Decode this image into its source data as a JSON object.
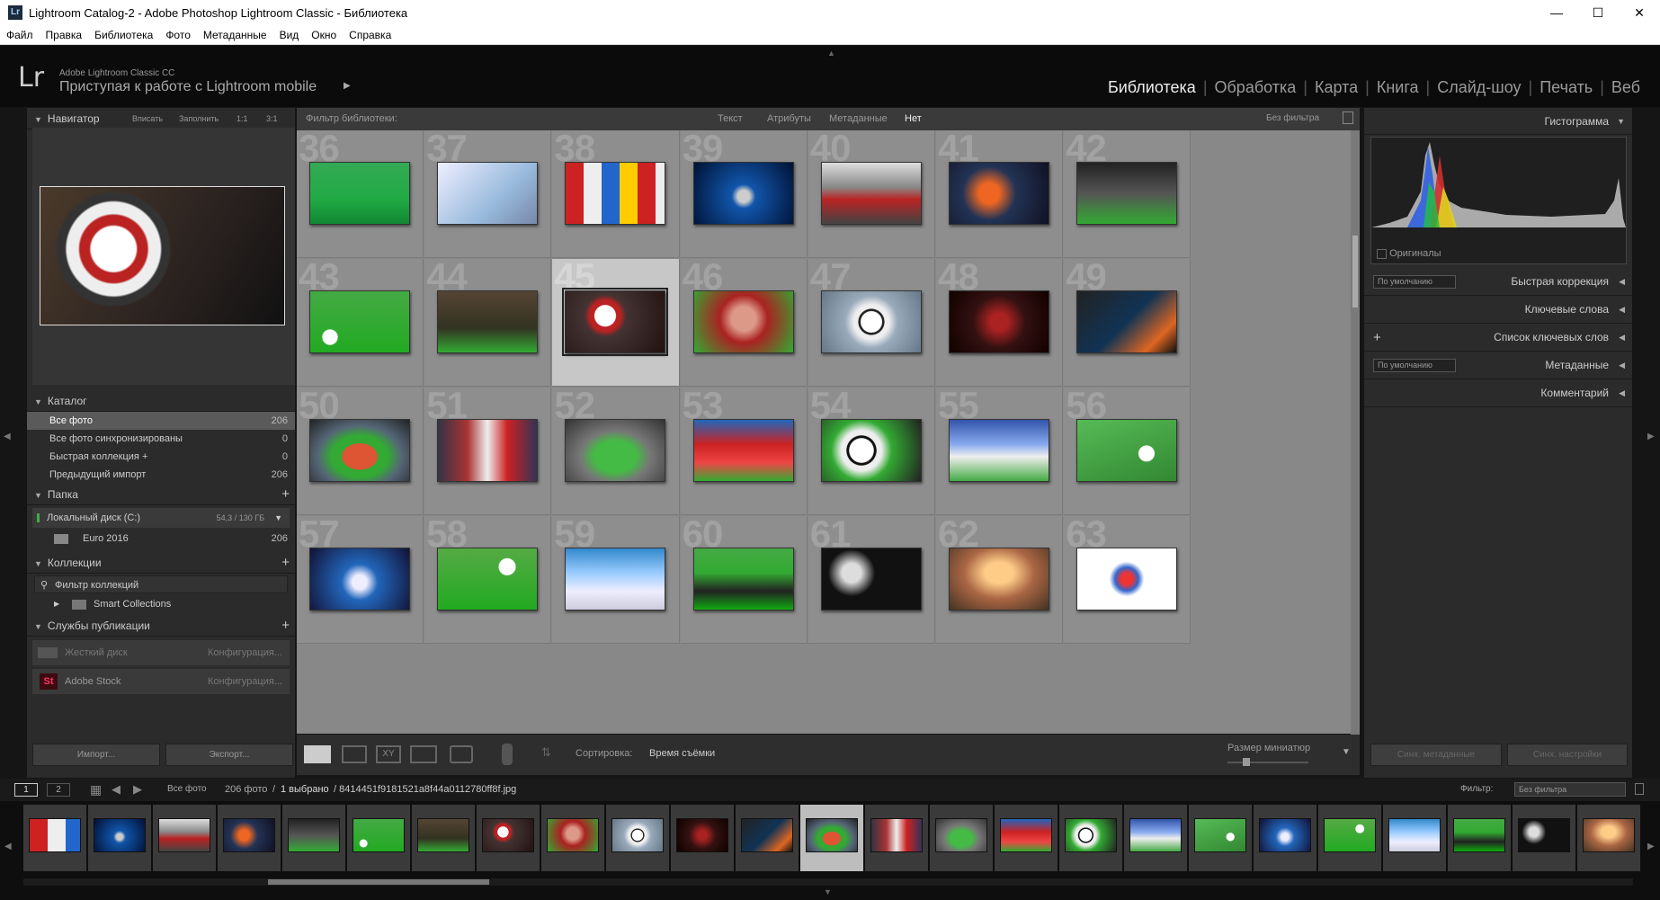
{
  "window": {
    "icon": "Lr",
    "title": "Lightroom Catalog-2 - Adobe Photoshop Lightroom Classic - Библиотека"
  },
  "menu": [
    "Файл",
    "Правка",
    "Библиотека",
    "Фото",
    "Метаданные",
    "Вид",
    "Окно",
    "Справка"
  ],
  "identity": {
    "logo": "Lr",
    "line1": "Adobe Lightroom Classic CC",
    "line2": "Приступая к работе с Lightroom mobile"
  },
  "modules": {
    "active": "Библиотека",
    "items": [
      "Обработка",
      "Карта",
      "Книга",
      "Слайд-шоу",
      "Печать",
      "Веб"
    ]
  },
  "navigator": {
    "title": "Навигатор",
    "zoom": [
      "Вписать",
      "Заполнить",
      "1:1",
      "3:1"
    ]
  },
  "catalog": {
    "title": "Каталог",
    "rows": [
      {
        "label": "Все фото",
        "count": "206"
      },
      {
        "label": "Все фото синхронизированы",
        "count": "0"
      },
      {
        "label": "Быстрая коллекция +",
        "count": "0"
      },
      {
        "label": "Предыдущий импорт",
        "count": "206"
      }
    ]
  },
  "folders": {
    "title": "Папка",
    "disk": "Локальный диск (C:)",
    "disk_size": "54,3 / 130 ГБ",
    "folder": "Euro 2016",
    "folder_count": "206"
  },
  "collections": {
    "title": "Коллекции",
    "filter": "Фильтр коллекций",
    "smart": "Smart Collections"
  },
  "publish": {
    "title": "Службы публикации",
    "services": [
      {
        "label": "Жесткий диск",
        "action": "Конфигурация..."
      },
      {
        "label": "Adobe Stock",
        "action": "Конфигурация..."
      }
    ]
  },
  "left_buttons": {
    "import": "Импорт...",
    "export": "Экспорт..."
  },
  "filterbar": {
    "label": "Фильтр библиотеки:",
    "tabs": [
      "Текст",
      "Атрибуты",
      "Метаданные",
      "Нет"
    ],
    "preset": "Без фильтра"
  },
  "grid": {
    "numbers": [
      "36",
      "37",
      "38",
      "39",
      "40",
      "41",
      "42",
      "43",
      "44",
      "45",
      "46",
      "47",
      "48",
      "49",
      "50",
      "51",
      "52",
      "53",
      "54",
      "55",
      "56",
      "57",
      "58",
      "59",
      "60",
      "61",
      "62",
      "63"
    ],
    "selected": "45"
  },
  "toolbar": {
    "sort_label": "Сортировка:",
    "sort_value": "Время съёмки",
    "thumb_size": "Размер миниатюр"
  },
  "right": {
    "histogram": "Гистограмма",
    "originals": "Оригиналы",
    "quick_dev": "Быстрая коррекция",
    "quick_dev_preset": "По умолчанию",
    "keywords": "Ключевые слова",
    "keyword_list": "Список ключевых слов",
    "metadata": "Метаданные",
    "metadata_preset": "По умолчанию",
    "comments": "Комментарий",
    "sync_meta": "Синх. метаданные",
    "sync_settings": "Синх. настройки"
  },
  "filmbar": {
    "page1": "1",
    "page2": "2",
    "source": "Все фото",
    "count": "206 фото",
    "sep": "/",
    "selected": "1 выбрано",
    "file": "/ 8414451f9181521a8f44a0112780ff8f.jpg",
    "filter_label": "Фильтр:",
    "filter_value": "Без фильтра"
  },
  "colors": {
    "accent": "#ececec",
    "grid_bg": "#888888",
    "selected_cell": "#c7c7c7"
  }
}
